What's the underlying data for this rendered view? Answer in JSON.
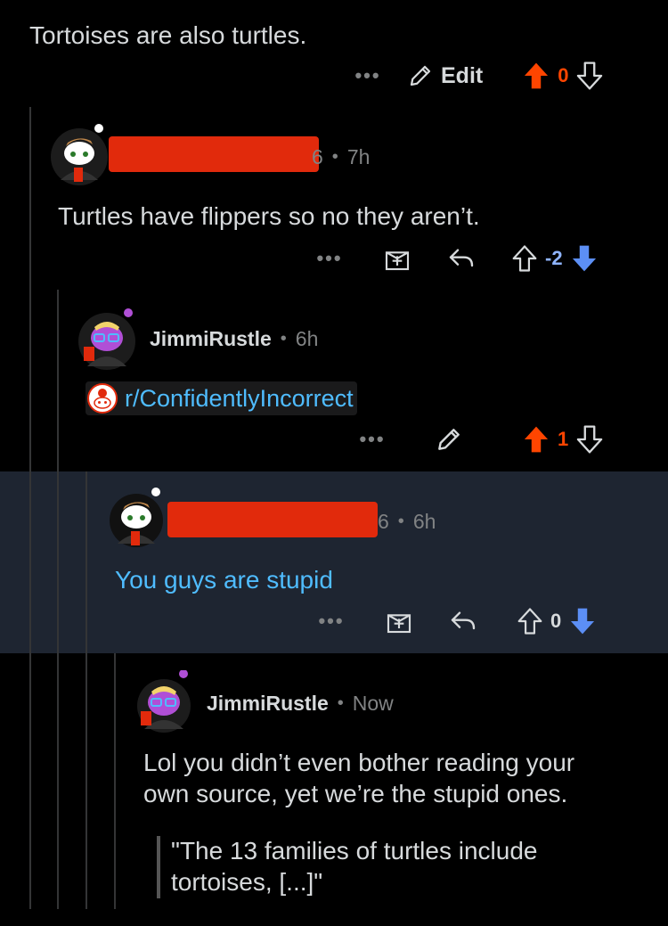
{
  "comments": {
    "top": {
      "text": "Tortoises are also turtles.",
      "more": "•••",
      "edit_label": "Edit",
      "score": "0"
    },
    "c1": {
      "username_suffix": "6",
      "time": "7h",
      "text": "Turtles have flippers so no they aren’t.",
      "more": "•••",
      "score": "-2"
    },
    "c2": {
      "username": "JimmiRustle",
      "time": "6h",
      "link": "r/ConfidentlyIncorrect",
      "more": "•••",
      "score": "1"
    },
    "c3": {
      "username_suffix": "6",
      "time": "6h",
      "text": "You guys are stupid",
      "more": "•••",
      "score": "0"
    },
    "c4": {
      "username": "JimmiRustle",
      "time": "Now",
      "text_line1": "Lol you didn’t even bother reading your",
      "text_line2": "own source, yet we’re the stupid ones.",
      "quote_line1": "\"The 13 families of turtles include",
      "quote_line2": "tortoises, [...]\""
    },
    "separator": "•"
  },
  "colors": {
    "background": "#000000",
    "highlight": "#1e2531",
    "upvote": "#ff4500",
    "downvote": "#5c8ff5",
    "link": "#4fbcff",
    "redaction": "#e12a0c",
    "text": "#d7dadc",
    "meta": "#818384"
  },
  "icons": [
    "more-icon",
    "pencil-icon",
    "upvote-icon",
    "downvote-icon",
    "award-icon",
    "reply-icon",
    "subreddit-icon"
  ]
}
